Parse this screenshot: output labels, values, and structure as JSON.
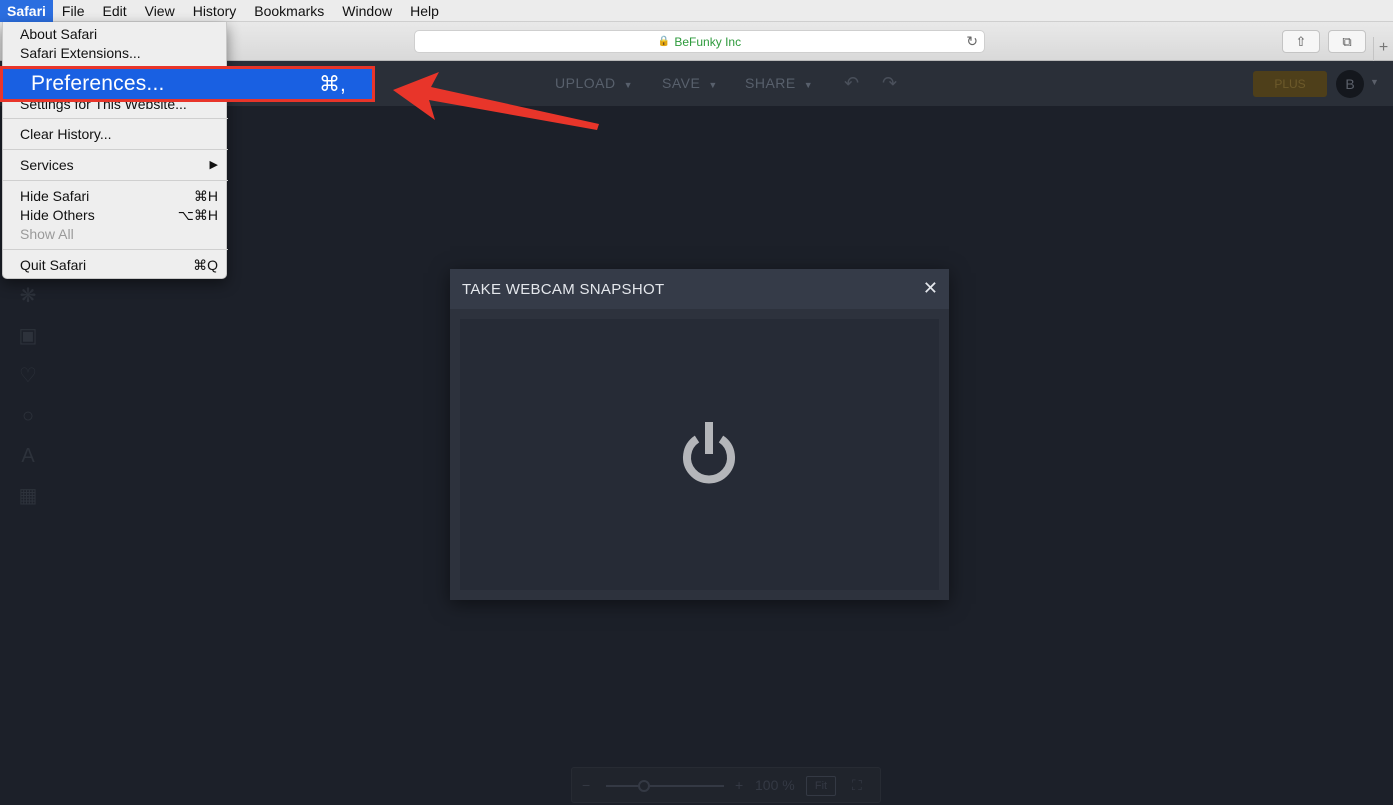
{
  "menubar": {
    "items": [
      "Safari",
      "File",
      "Edit",
      "View",
      "History",
      "Bookmarks",
      "Window",
      "Help"
    ]
  },
  "browser": {
    "address": "BeFunky Inc",
    "lock_icon": "lock-icon",
    "reload_icon": "reload-icon",
    "share_icon": "share-icon",
    "tabs_icon": "tabs-icon",
    "newtab_icon": "plus-icon"
  },
  "app_header": {
    "upload_label": "UPLOAD",
    "save_label": "SAVE",
    "share_label": "SHARE",
    "plus_label": "PLUS",
    "avatar_initial": "B"
  },
  "safari_menu": {
    "about": "About Safari",
    "extensions": "Safari Extensions...",
    "preferences": "Preferences...",
    "preferences_shortcut": "⌘,",
    "settings_website": "Settings for This Website...",
    "clear_history": "Clear History...",
    "services": "Services",
    "services_arrow": "▶",
    "hide_safari": "Hide Safari",
    "hide_safari_shortcut": "⌘H",
    "hide_others": "Hide Others",
    "hide_others_shortcut": "⌥⌘H",
    "show_all": "Show All",
    "quit": "Quit Safari",
    "quit_shortcut": "⌘Q"
  },
  "modal": {
    "title": "TAKE WEBCAM SNAPSHOT",
    "close": "✕"
  },
  "zoom": {
    "minus": "−",
    "plus": "+",
    "level": "100 %",
    "fit_label": "Fit"
  },
  "colors": {
    "highlight": "#1960e2",
    "annotation_red": "#e8352a",
    "app_bg": "#1c2029",
    "modal_bg": "#2d323d"
  }
}
